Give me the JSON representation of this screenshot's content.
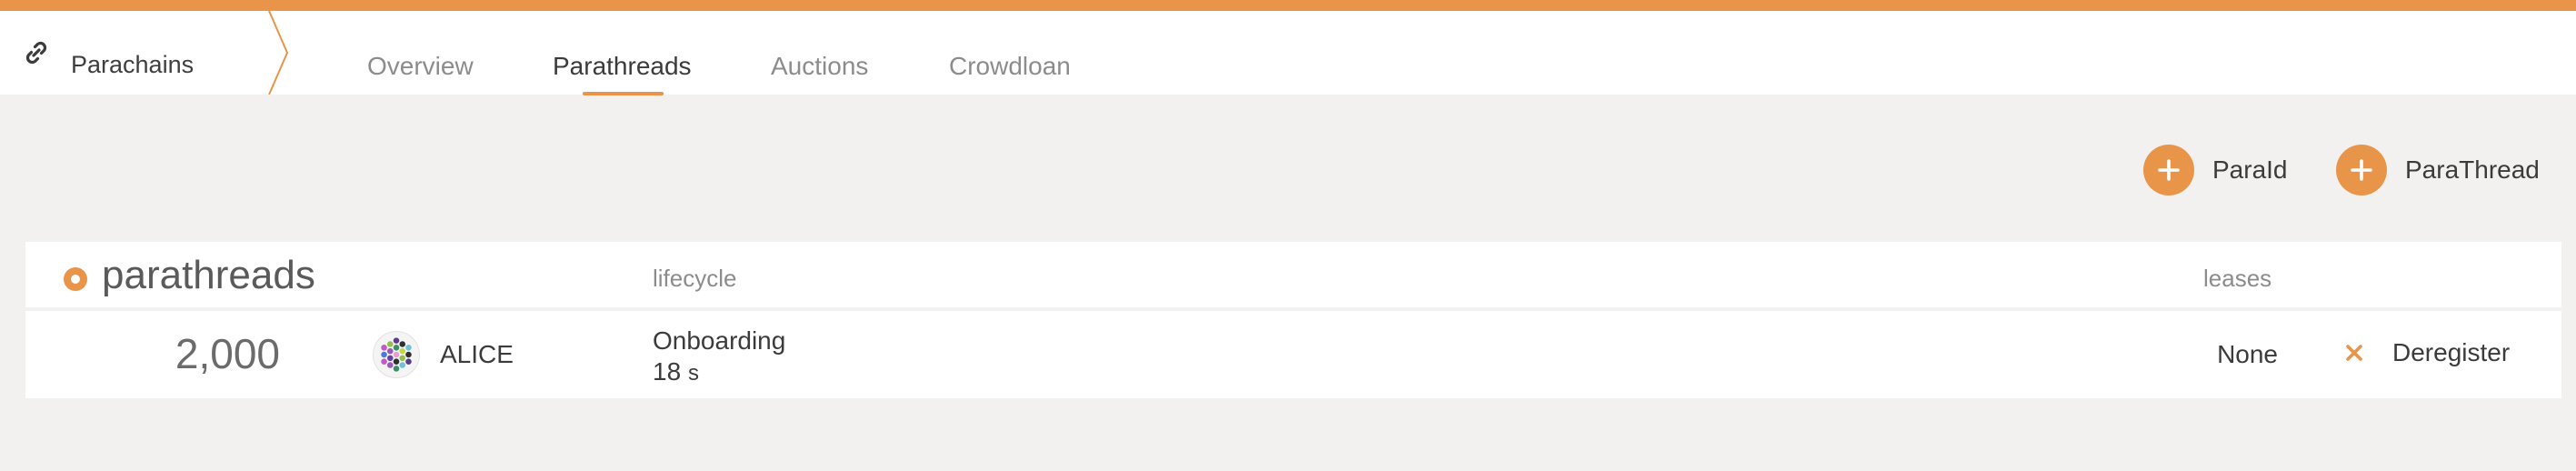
{
  "nav": {
    "brand": "Parachains",
    "tabs": [
      {
        "label": "Overview",
        "active": false
      },
      {
        "label": "Parathreads",
        "active": true
      },
      {
        "label": "Auctions",
        "active": false
      },
      {
        "label": "Crowdloan",
        "active": false
      }
    ]
  },
  "actions": {
    "paraid_label": "ParaId",
    "parathread_label": "ParaThread"
  },
  "table": {
    "title": "parathreads",
    "columns": {
      "lifecycle": "lifecycle",
      "leases": "leases"
    },
    "rows": [
      {
        "id": "2,000",
        "account": "ALICE",
        "lifecycle": "Onboarding",
        "time_value": "18",
        "time_unit": "s",
        "leases": "None",
        "action": "Deregister"
      }
    ]
  },
  "colors": {
    "accent": "#e8954a",
    "background": "#f2f1f0"
  },
  "icons": {
    "brand": "link-icon",
    "add": "plus-icon",
    "deregister": "close-icon"
  }
}
